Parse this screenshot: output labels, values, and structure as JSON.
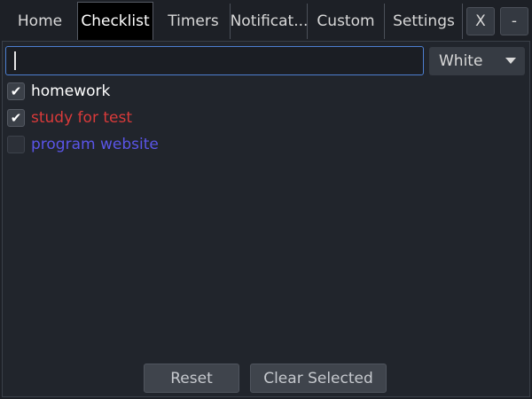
{
  "tabs": [
    {
      "label": "Home",
      "active": false
    },
    {
      "label": "Checklist",
      "active": true
    },
    {
      "label": "Timers",
      "active": false
    },
    {
      "label": "Notificat...",
      "active": false
    },
    {
      "label": "Custom",
      "active": false
    },
    {
      "label": "Settings",
      "active": false
    }
  ],
  "window_buttons": {
    "close_label": "X",
    "minimize_label": "-"
  },
  "input": {
    "value": "",
    "placeholder": ""
  },
  "color_select": {
    "selected": "White",
    "icon": "chevron-down-icon"
  },
  "items": [
    {
      "label": "homework",
      "checked": true,
      "color": "#ffffff"
    },
    {
      "label": "study for test",
      "checked": true,
      "color": "#d93a3a"
    },
    {
      "label": "program website",
      "checked": false,
      "color": "#5a55e8"
    }
  ],
  "buttons": {
    "reset_label": "Reset",
    "clear_label": "Clear Selected"
  },
  "colors": {
    "background": "#1d2026",
    "accent": "#4d7fd0"
  }
}
